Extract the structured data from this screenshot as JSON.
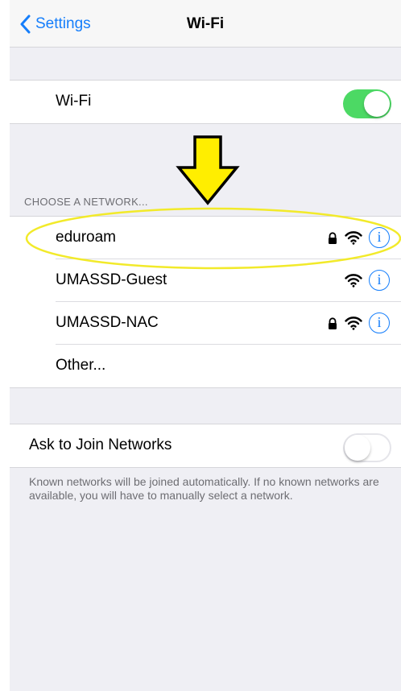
{
  "navbar": {
    "back_label": "Settings",
    "title": "Wi-Fi"
  },
  "wifi_row": {
    "label": "Wi-Fi",
    "toggle_on": true
  },
  "networks_header": "CHOOSE A NETWORK...",
  "networks": [
    {
      "name": "eduroam",
      "secured": true
    },
    {
      "name": "UMASSD-Guest",
      "secured": false
    },
    {
      "name": "UMASSD-NAC",
      "secured": true
    }
  ],
  "other_label": "Other...",
  "ask_join": {
    "label": "Ask to Join Networks",
    "toggle_on": false
  },
  "footer_note": "Known networks will be joined automatically. If no known networks are available, you will have to manually select a network.",
  "info_glyph": "i",
  "colors": {
    "accent": "#157efb",
    "toggle_on": "#4cd964",
    "annotation": "#ffee00",
    "background": "#efeff4"
  },
  "icons": {
    "back": "chevron-left-icon",
    "lock": "lock-icon",
    "wifi": "wifi-signal-icon",
    "info": "info-icon",
    "arrow": "arrow-down-icon"
  }
}
